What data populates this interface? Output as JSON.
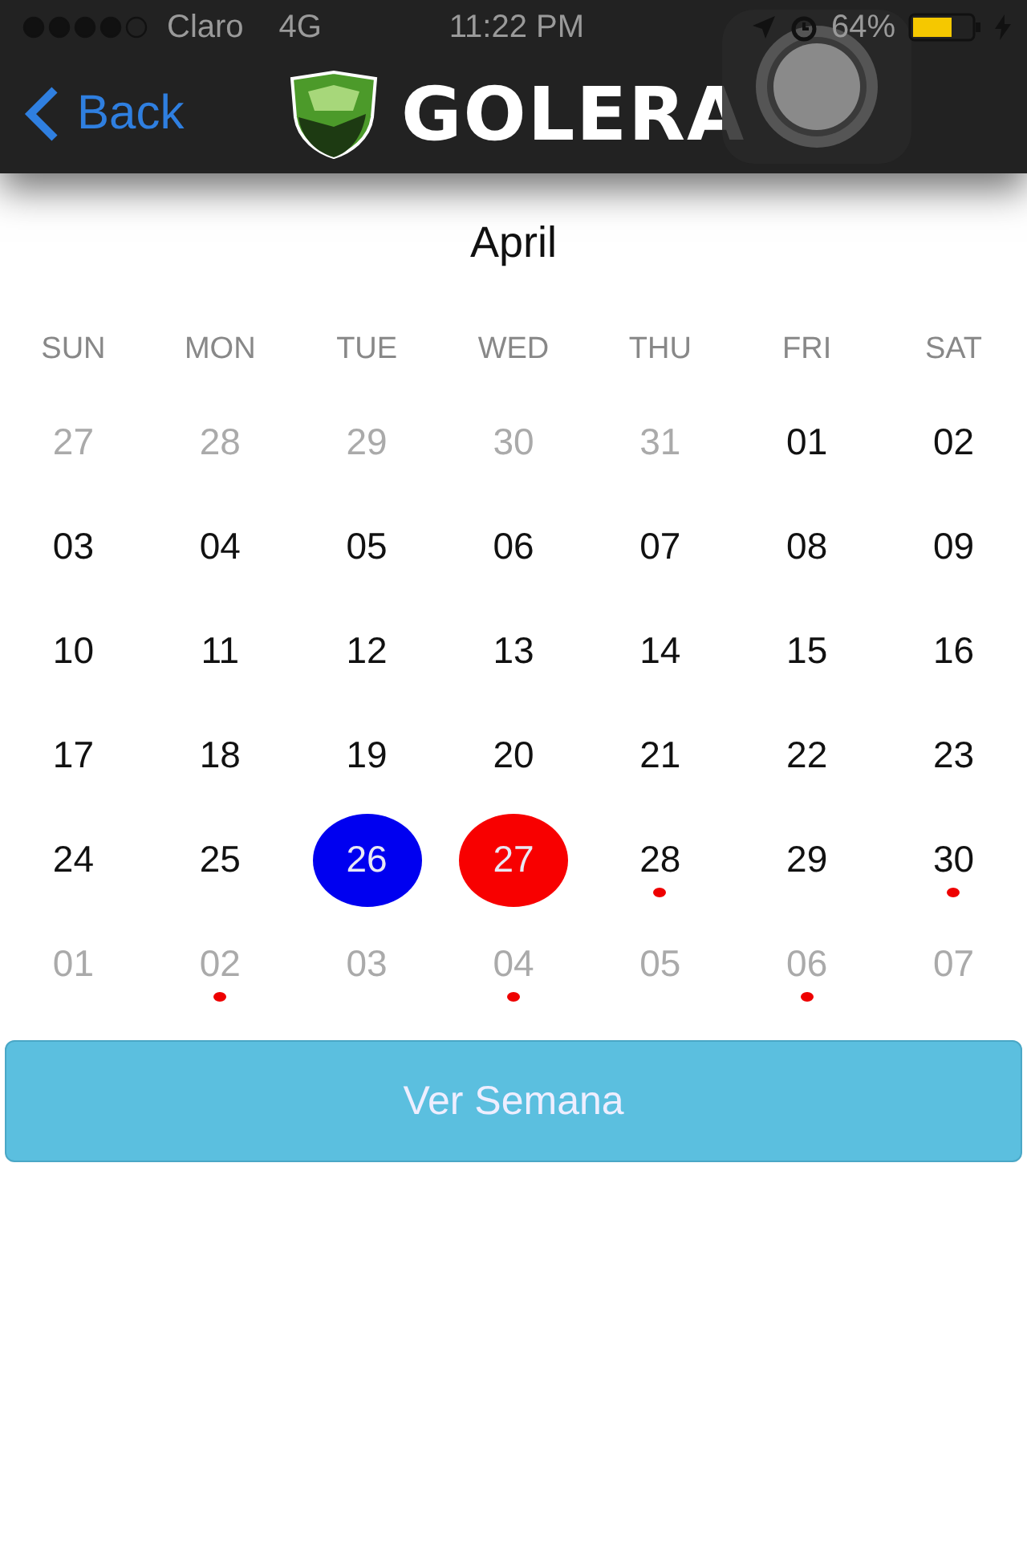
{
  "status_bar": {
    "carrier": "Claro",
    "network": "4G",
    "time": "11:22 PM",
    "battery": "64%"
  },
  "nav": {
    "back": "Back",
    "brand": "GOLERA"
  },
  "calendar": {
    "month": "April",
    "weekdays": [
      "SUN",
      "MON",
      "TUE",
      "WED",
      "THU",
      "FRI",
      "SAT"
    ],
    "weeks": [
      [
        {
          "day": "27",
          "outside": true,
          "event": false,
          "selected": false,
          "today": false
        },
        {
          "day": "28",
          "outside": true,
          "event": false,
          "selected": false,
          "today": false
        },
        {
          "day": "29",
          "outside": true,
          "event": false,
          "selected": false,
          "today": false
        },
        {
          "day": "30",
          "outside": true,
          "event": false,
          "selected": false,
          "today": false
        },
        {
          "day": "31",
          "outside": true,
          "event": false,
          "selected": false,
          "today": false
        },
        {
          "day": "01",
          "outside": false,
          "event": false,
          "selected": false,
          "today": false
        },
        {
          "day": "02",
          "outside": false,
          "event": false,
          "selected": false,
          "today": false
        }
      ],
      [
        {
          "day": "03",
          "outside": false,
          "event": false,
          "selected": false,
          "today": false
        },
        {
          "day": "04",
          "outside": false,
          "event": false,
          "selected": false,
          "today": false
        },
        {
          "day": "05",
          "outside": false,
          "event": false,
          "selected": false,
          "today": false
        },
        {
          "day": "06",
          "outside": false,
          "event": false,
          "selected": false,
          "today": false
        },
        {
          "day": "07",
          "outside": false,
          "event": false,
          "selected": false,
          "today": false
        },
        {
          "day": "08",
          "outside": false,
          "event": false,
          "selected": false,
          "today": false
        },
        {
          "day": "09",
          "outside": false,
          "event": false,
          "selected": false,
          "today": false
        }
      ],
      [
        {
          "day": "10",
          "outside": false,
          "event": false,
          "selected": false,
          "today": false
        },
        {
          "day": "11",
          "outside": false,
          "event": false,
          "selected": false,
          "today": false
        },
        {
          "day": "12",
          "outside": false,
          "event": false,
          "selected": false,
          "today": false
        },
        {
          "day": "13",
          "outside": false,
          "event": false,
          "selected": false,
          "today": false
        },
        {
          "day": "14",
          "outside": false,
          "event": false,
          "selected": false,
          "today": false
        },
        {
          "day": "15",
          "outside": false,
          "event": false,
          "selected": false,
          "today": false
        },
        {
          "day": "16",
          "outside": false,
          "event": false,
          "selected": false,
          "today": false
        }
      ],
      [
        {
          "day": "17",
          "outside": false,
          "event": false,
          "selected": false,
          "today": false
        },
        {
          "day": "18",
          "outside": false,
          "event": false,
          "selected": false,
          "today": false
        },
        {
          "day": "19",
          "outside": false,
          "event": false,
          "selected": false,
          "today": false
        },
        {
          "day": "20",
          "outside": false,
          "event": false,
          "selected": false,
          "today": false
        },
        {
          "day": "21",
          "outside": false,
          "event": false,
          "selected": false,
          "today": false
        },
        {
          "day": "22",
          "outside": false,
          "event": false,
          "selected": false,
          "today": false
        },
        {
          "day": "23",
          "outside": false,
          "event": false,
          "selected": false,
          "today": false
        }
      ],
      [
        {
          "day": "24",
          "outside": false,
          "event": false,
          "selected": false,
          "today": false
        },
        {
          "day": "25",
          "outside": false,
          "event": false,
          "selected": false,
          "today": false
        },
        {
          "day": "26",
          "outside": false,
          "event": false,
          "selected": true,
          "today": false
        },
        {
          "day": "27",
          "outside": false,
          "event": false,
          "selected": false,
          "today": true
        },
        {
          "day": "28",
          "outside": false,
          "event": true,
          "selected": false,
          "today": false
        },
        {
          "day": "29",
          "outside": false,
          "event": false,
          "selected": false,
          "today": false
        },
        {
          "day": "30",
          "outside": false,
          "event": true,
          "selected": false,
          "today": false
        }
      ],
      [
        {
          "day": "01",
          "outside": true,
          "event": false,
          "selected": false,
          "today": false
        },
        {
          "day": "02",
          "outside": true,
          "event": true,
          "selected": false,
          "today": false
        },
        {
          "day": "03",
          "outside": true,
          "event": false,
          "selected": false,
          "today": false
        },
        {
          "day": "04",
          "outside": true,
          "event": true,
          "selected": false,
          "today": false
        },
        {
          "day": "05",
          "outside": true,
          "event": false,
          "selected": false,
          "today": false
        },
        {
          "day": "06",
          "outside": true,
          "event": true,
          "selected": false,
          "today": false
        },
        {
          "day": "07",
          "outside": true,
          "event": false,
          "selected": false,
          "today": false
        }
      ]
    ]
  },
  "week_button": "Ver Semana"
}
